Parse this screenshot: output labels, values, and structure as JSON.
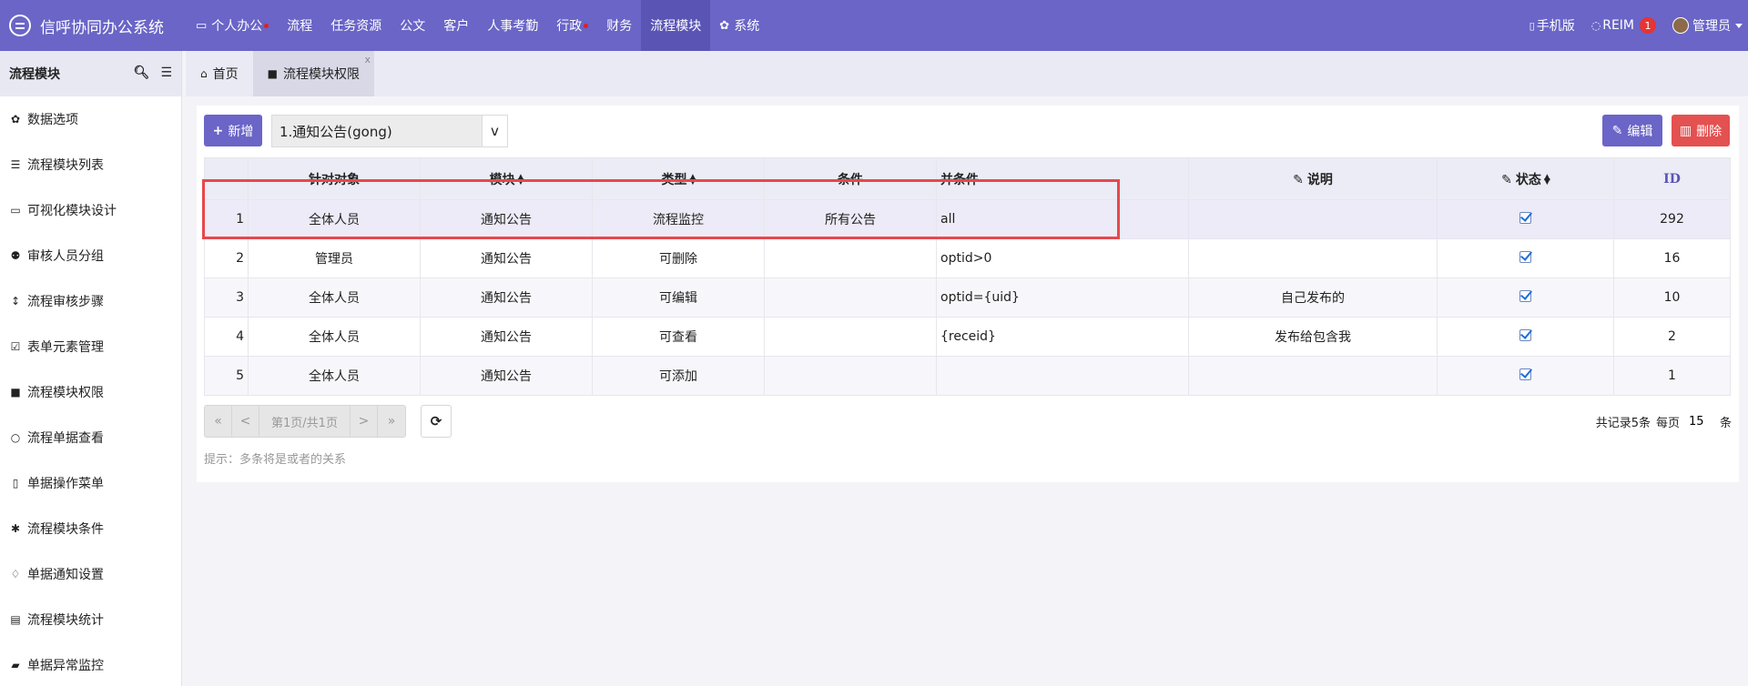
{
  "app": {
    "title": "信呼协同办公系统"
  },
  "nav": [
    {
      "label": "个人办公",
      "icon": "monitor-icon",
      "dot": true
    },
    {
      "label": "流程",
      "dot": false
    },
    {
      "label": "任务资源",
      "dot": false
    },
    {
      "label": "公文",
      "dot": false
    },
    {
      "label": "客户",
      "dot": false
    },
    {
      "label": "人事考勤",
      "dot": false
    },
    {
      "label": "行政",
      "dot": true
    },
    {
      "label": "财务",
      "dot": false
    },
    {
      "label": "流程模块",
      "dot": false,
      "active": true
    },
    {
      "label": "系统",
      "icon": "gear-icon",
      "dot": false
    }
  ],
  "topright": {
    "mobile": "手机版",
    "reim": "REIM",
    "reim_badge": "1",
    "user": "管理员"
  },
  "sidebar": {
    "title": "流程模块",
    "items": [
      {
        "label": "数据选项",
        "icon": "gear-icon"
      },
      {
        "label": "流程模块列表",
        "icon": "list-icon"
      },
      {
        "label": "可视化模块设计",
        "icon": "monitor-icon"
      },
      {
        "label": "审核人员分组",
        "icon": "users-icon"
      },
      {
        "label": "流程审核步骤",
        "icon": "vertical-arrows-icon"
      },
      {
        "label": "表单元素管理",
        "icon": "checkbox-icon"
      },
      {
        "label": "流程模块权限",
        "icon": "lock-icon"
      },
      {
        "label": "流程单据查看",
        "icon": "search-icon"
      },
      {
        "label": "单据操作菜单",
        "icon": "bookmark-icon"
      },
      {
        "label": "流程模块条件",
        "icon": "asterisk-icon"
      },
      {
        "label": "单据通知设置",
        "icon": "bell-icon"
      },
      {
        "label": "流程模块统计",
        "icon": "bar-chart-icon"
      },
      {
        "label": "单据异常监控",
        "icon": "briefcase-icon"
      }
    ]
  },
  "tabs": [
    {
      "label": "首页",
      "icon": "home-icon"
    },
    {
      "label": "流程模块权限",
      "icon": "lock-icon",
      "active": true,
      "close": "x"
    }
  ],
  "toolbar": {
    "add_label": "新增",
    "select_value": "1.通知公告(gong)",
    "select_arrow": "v",
    "edit_label": "编辑",
    "delete_label": "删除"
  },
  "table": {
    "headers": [
      "",
      "针对对象",
      "模块",
      "类型",
      "条件",
      "并条件",
      "说明",
      "状态",
      "ID"
    ],
    "rows": [
      {
        "num": "1",
        "target": "全体人员",
        "module": "通知公告",
        "type": "流程监控",
        "cond": "所有公告",
        "andcond": "all",
        "desc": "",
        "status": true,
        "id": "292"
      },
      {
        "num": "2",
        "target": "管理员",
        "module": "通知公告",
        "type": "可删除",
        "cond": "",
        "andcond": "optid>0",
        "desc": "",
        "status": true,
        "id": "16"
      },
      {
        "num": "3",
        "target": "全体人员",
        "module": "通知公告",
        "type": "可编辑",
        "cond": "",
        "andcond": "optid={uid}",
        "desc": "自己发布的",
        "status": true,
        "id": "10"
      },
      {
        "num": "4",
        "target": "全体人员",
        "module": "通知公告",
        "type": "可查看",
        "cond": "",
        "andcond": "{receid}",
        "desc": "发布给包含我",
        "status": true,
        "id": "2"
      },
      {
        "num": "5",
        "target": "全体人员",
        "module": "通知公告",
        "type": "可添加",
        "cond": "",
        "andcond": "",
        "desc": "",
        "status": true,
        "id": "1"
      }
    ]
  },
  "pager": {
    "first": "«",
    "prev": "<",
    "info": "第1页/共1页",
    "next": ">",
    "last": "»"
  },
  "tip": "提示：多条将是或者的关系",
  "records": {
    "total_text": "共记录5条",
    "per_page_label": "每页",
    "per_page": "15",
    "unit": "条"
  },
  "colors": {
    "primary": "#6a65c7",
    "danger": "#e45151",
    "highlight": "#e8474b"
  }
}
